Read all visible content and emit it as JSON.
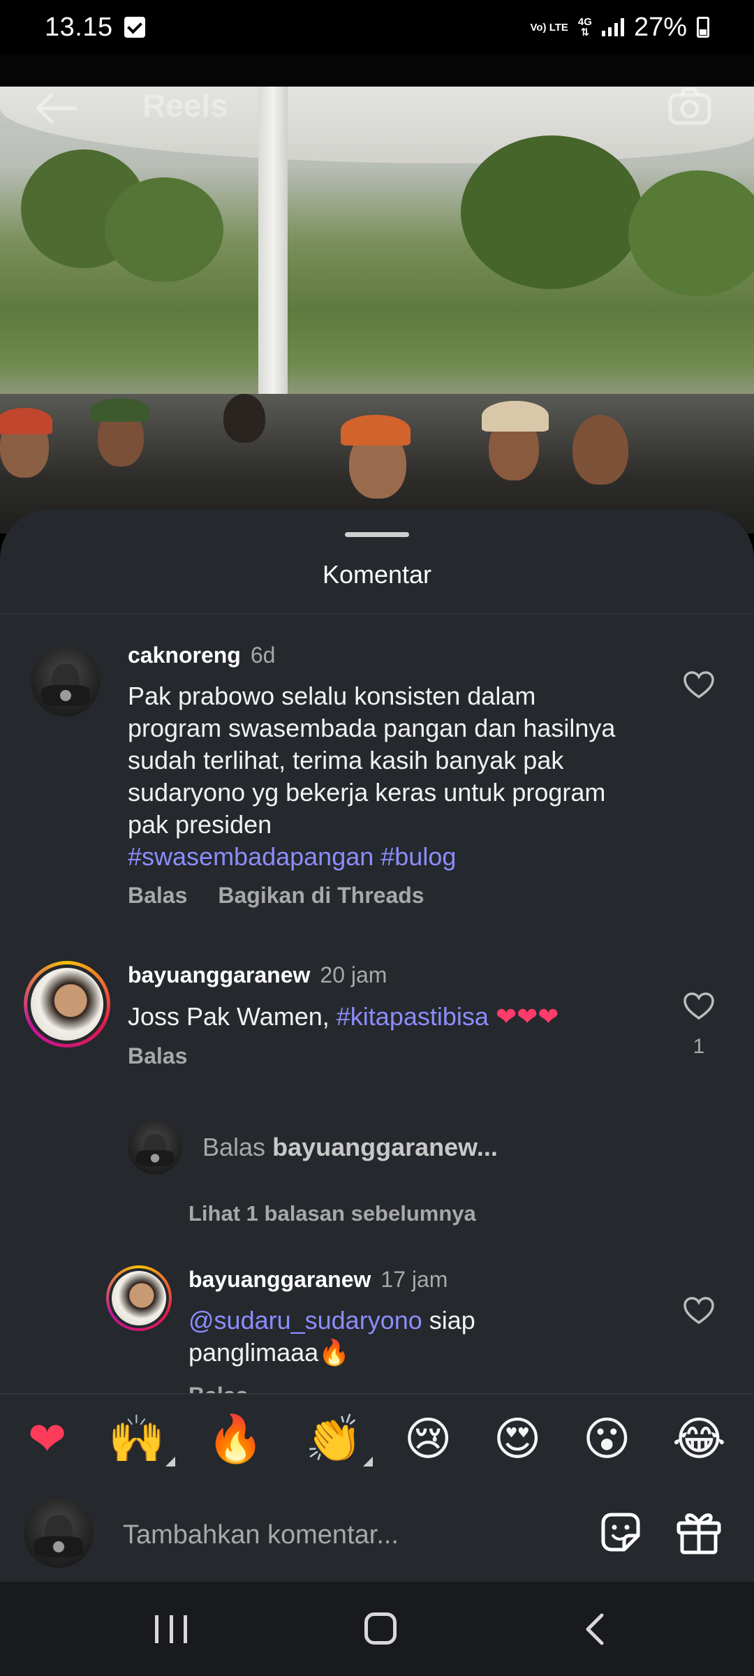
{
  "status_bar": {
    "time": "13.15",
    "network_volte": "Vo) LTE",
    "network_4g": "4G",
    "battery": "27%"
  },
  "video_header": {
    "title": "Reels"
  },
  "sheet": {
    "title": "Komentar"
  },
  "comments": [
    {
      "username": "caknoreng",
      "time": "6d",
      "text": "Pak prabowo selalu konsisten dalam program swasembada pangan dan hasilnya sudah terlihat, terima kasih banyak pak sudaryono yg bekerja keras untuk program pak presiden",
      "hashtags": "#swasembadapangan #bulog",
      "reply_label": "Balas",
      "share_label": "Bagikan di Threads"
    },
    {
      "username": "bayuanggaranew",
      "time": "20 jam",
      "text": "Joss Pak Wamen,",
      "hashtag": "#kitapastibisa",
      "emojis": "❤❤❤",
      "reply_label": "Balas",
      "like_count": "1"
    }
  ],
  "reply_prompt": {
    "prefix": "Balas",
    "target": "bayuanggaranew..."
  },
  "view_previous": "Lihat 1 balasan sebelumnya",
  "reply": {
    "username": "bayuanggaranew",
    "time": "17 jam",
    "mention": "@sudaru_sudaryono",
    "text": "siap",
    "text_line2": "panglimaaa🔥",
    "reply_label": "Balas"
  },
  "emoji_bar": [
    "❤",
    "🙌",
    "🔥",
    "👏",
    "😢",
    "😍",
    "😮",
    "😂"
  ],
  "input": {
    "placeholder": "Tambahkan komentar..."
  },
  "colors": {
    "sheet_bg": "#25282c",
    "hashtag": "#8c8dff",
    "muted": "#a8a8a8"
  }
}
